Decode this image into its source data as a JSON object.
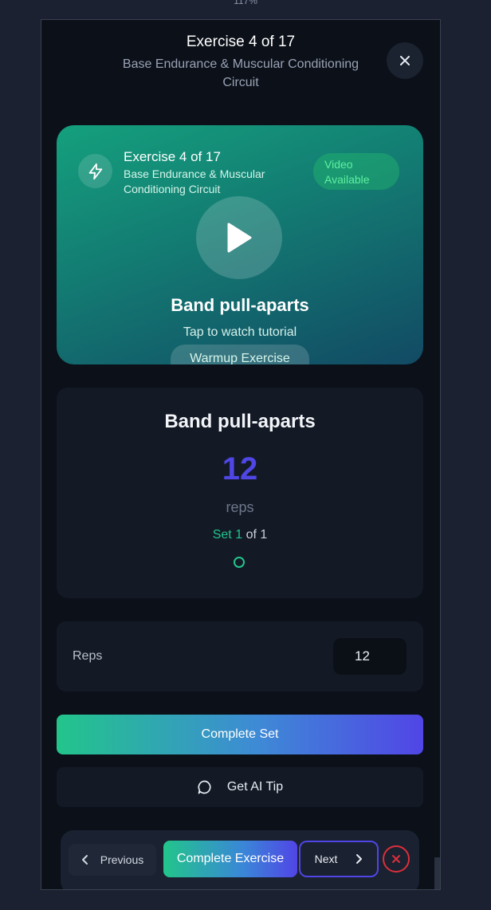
{
  "zoom_level": "117%",
  "header": {
    "title": "Exercise 4 of 17",
    "subtitle": "Base Endurance & Muscular Conditioning Circuit",
    "close_icon": "close-icon"
  },
  "video_card": {
    "title": "Exercise 4 of 17",
    "subtitle": "Base Endurance & Muscular Conditioning Circuit",
    "badge": "Video Available",
    "exercise_name": "Band pull-aparts",
    "tap_hint": "Tap to watch tutorial",
    "category_badge": "Warmup Exercise",
    "icons": [
      "bolt-icon",
      "play-icon"
    ],
    "colors": {
      "badge_text": "#5ef0a0",
      "gradient_start": "#14a07d",
      "gradient_end": "#124a64"
    }
  },
  "set_card": {
    "exercise_name": "Band pull-aparts",
    "target": "12",
    "unit": "reps",
    "set_word": "Set",
    "set_current": "1",
    "set_of": "of",
    "set_total": "1",
    "sets_completed": 0,
    "colors": {
      "target": "#4f46e5",
      "set_accent": "#22c58b"
    }
  },
  "reps_input": {
    "label": "Reps",
    "value": "12"
  },
  "actions": {
    "complete_set": "Complete Set",
    "ai_tip": "Get AI Tip"
  },
  "bottom_nav": {
    "previous": "Previous",
    "complete_exercise": "Complete Exercise",
    "next": "Next",
    "exit_icon": "x-circle-icon",
    "colors": {
      "exit": "#dc2f3b",
      "next_border": "#4f46e5"
    }
  }
}
